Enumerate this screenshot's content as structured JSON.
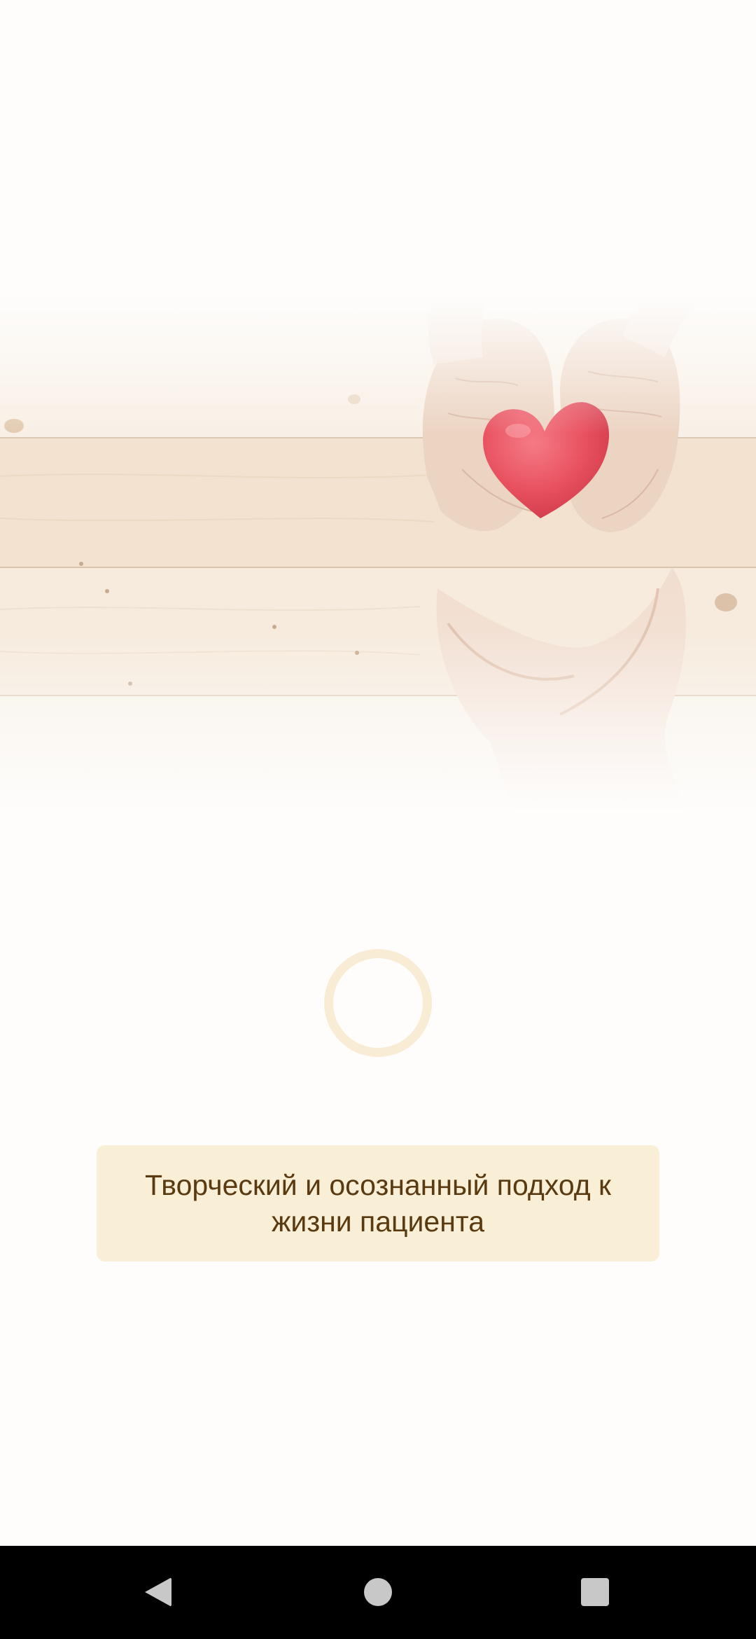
{
  "hero": {
    "image": "hands-holding-red-heart-on-wooden-planks"
  },
  "loader": {
    "icon": "loading-ring-icon"
  },
  "tagline": {
    "text": "Творческий и осознанный подход к жизни пациента"
  },
  "navbar": {
    "back_icon": "back-triangle-icon",
    "home_icon": "home-circle-icon",
    "recents_icon": "recents-square-icon"
  },
  "colors": {
    "background": "#fefdfc",
    "card_background": "#f9eed6",
    "card_text": "#5a3a10",
    "loader_ring": "#f8ecd4",
    "navbar": "#000000"
  }
}
